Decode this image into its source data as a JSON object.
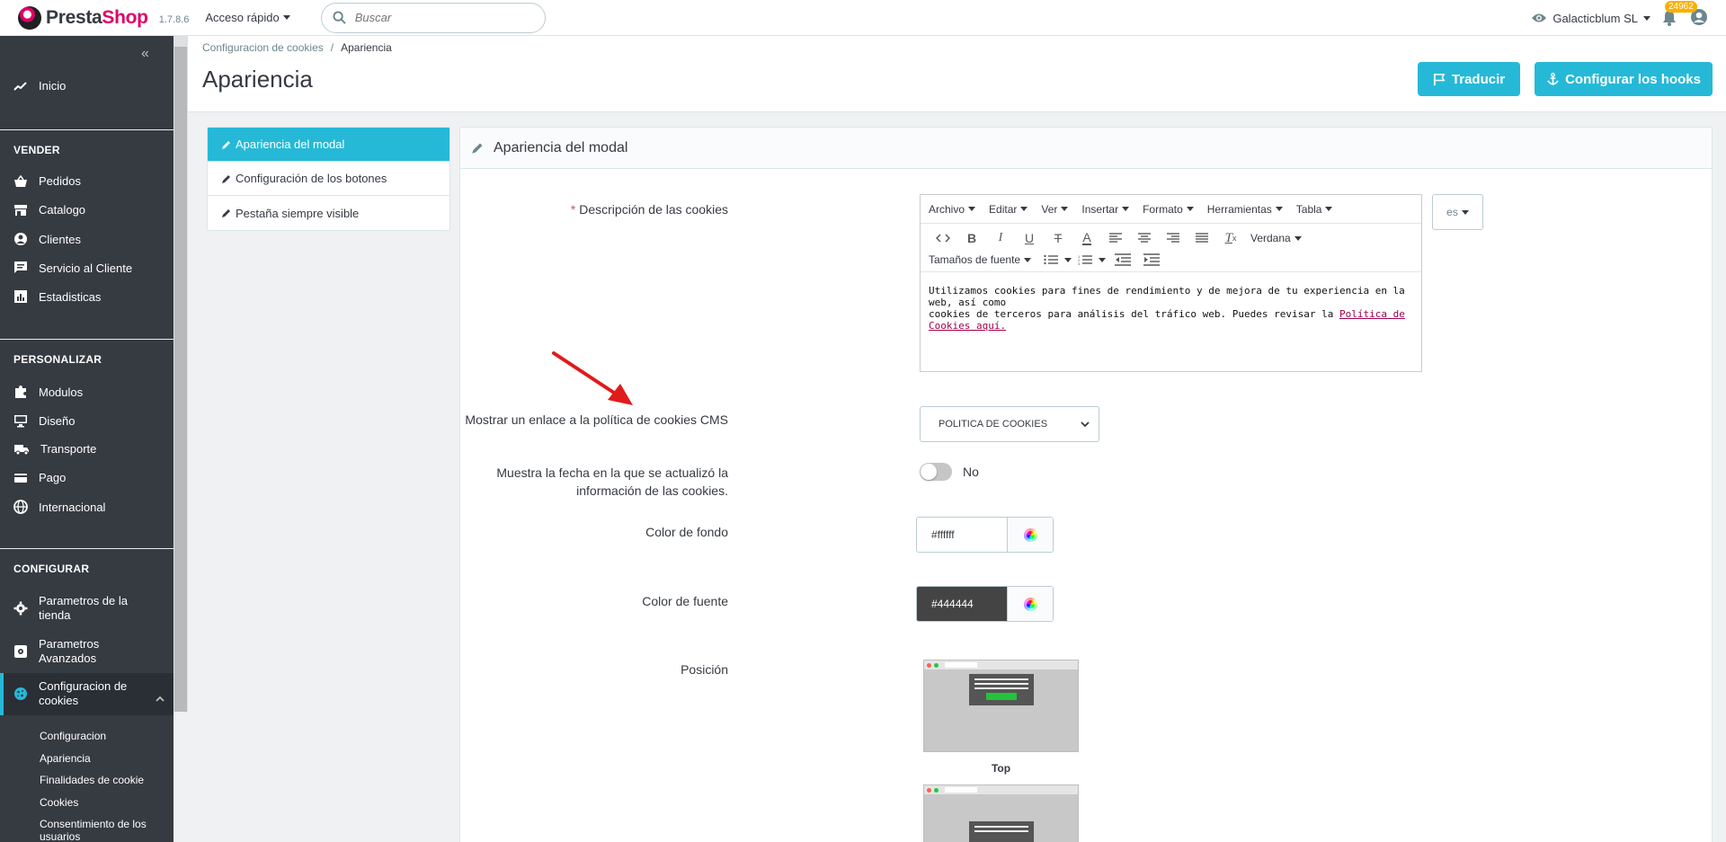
{
  "header": {
    "logo_text_1": "Presta",
    "logo_text_2": "Shop",
    "version": "1.7.8.6",
    "quick_access": "Acceso rápido",
    "search_placeholder": "Buscar",
    "shop_name": "Galacticblum SL",
    "notifications_count": "24962"
  },
  "sidebar": {
    "items": [
      {
        "label": "Inicio",
        "icon": "trend-icon"
      },
      {
        "section": "VENDER"
      },
      {
        "label": "Pedidos",
        "icon": "basket-icon"
      },
      {
        "label": "Catalogo",
        "icon": "store-icon"
      },
      {
        "label": "Clientes",
        "icon": "user-icon"
      },
      {
        "label": "Servicio al Cliente",
        "icon": "chat-icon"
      },
      {
        "label": "Estadisticas",
        "icon": "chart-icon"
      },
      {
        "section": "PERSONALIZAR"
      },
      {
        "label": "Modulos",
        "icon": "puzzle-icon"
      },
      {
        "label": "Diseño",
        "icon": "monitor-icon"
      },
      {
        "label": "Transporte",
        "icon": "truck-icon"
      },
      {
        "label": "Pago",
        "icon": "card-icon"
      },
      {
        "label": "Internacional",
        "icon": "globe-icon"
      },
      {
        "section": "CONFIGURAR"
      },
      {
        "label": "Parametros de la tienda",
        "icon": "gear-icon"
      },
      {
        "label": "Parametros Avanzados",
        "icon": "cog-box-icon"
      },
      {
        "label": "Configuracion de cookies",
        "icon": "cookie-icon"
      }
    ],
    "sub_items": [
      "Configuracion",
      "Apariencia",
      "Finalidades de cookie",
      "Cookies",
      "Consentimiento de los usuarios"
    ],
    "labels": {
      "inicio": "Inicio",
      "vender": "VENDER",
      "pedidos": "Pedidos",
      "catalogo": "Catalogo",
      "clientes": "Clientes",
      "servicio": "Servicio al Cliente",
      "estadisticas": "Estadisticas",
      "personalizar": "PERSONALIZAR",
      "modulos": "Modulos",
      "diseno": "Diseño",
      "transporte": "Transporte",
      "pago": "Pago",
      "internacional": "Internacional",
      "configurar": "CONFIGURAR",
      "param_tienda_1": "Parametros de la",
      "param_tienda_2": "tienda",
      "param_avanzados_1": "Parametros",
      "param_avanzados_2": "Avanzados",
      "config_cookies_1": "Configuracion de",
      "config_cookies_2": "cookies",
      "sub_configuracion": "Configuracion",
      "sub_apariencia": "Apariencia",
      "sub_finalidades": "Finalidades de cookie",
      "sub_cookies": "Cookies",
      "sub_consentimiento_1": "Consentimiento de los",
      "sub_consentimiento_2": "usuarios"
    }
  },
  "page": {
    "breadcrumb_parent": "Configuracion de cookies",
    "breadcrumb_current": "Apariencia",
    "title": "Apariencia",
    "btn_translate": "Traducir",
    "btn_hooks": "Configurar los hooks"
  },
  "tabs": {
    "tab1": "Apariencia del modal",
    "tab2": "Configuración de los botones",
    "tab3": "Pestaña siempre visible"
  },
  "panel": {
    "title": "Apariencia del modal",
    "required_mark": "*",
    "label_description": "Descripción de las cookies",
    "label_link": "Mostrar un enlace a la política de cookies CMS",
    "label_date_1": "Muestra la fecha en la que se actualizó la",
    "label_date_2": "información de las cookies.",
    "label_bg_color": "Color de fondo",
    "label_font_color": "Color de fuente",
    "label_position": "Posición"
  },
  "editor": {
    "menu": [
      "Archivo",
      "Editar",
      "Ver",
      "Insertar",
      "Formato",
      "Herramientas",
      "Tabla"
    ],
    "font_name": "Verdana",
    "font_size": "Tamaños de fuente",
    "content_line1": "Utilizamos cookies para fines de rendimiento y de mejora de tu experiencia en la web, así como",
    "content_line2": "cookies de terceros para análisis del tráfico web. Puedes revisar la ",
    "content_link": "Política de Cookies aquí.",
    "lang": "es"
  },
  "fields": {
    "cms_select_value": "POLITICA DE COOKIES",
    "date_toggle_label": "No",
    "date_toggle_on": false,
    "bg_color_value": "#ffffff",
    "font_color_value": "#444444",
    "position_top_label": "Top"
  },
  "colors": {
    "accent": "#25b9d7",
    "sidebar": "#363a41",
    "brand_pink": "#df0067",
    "annotation_arrow": "#e01b1b"
  }
}
